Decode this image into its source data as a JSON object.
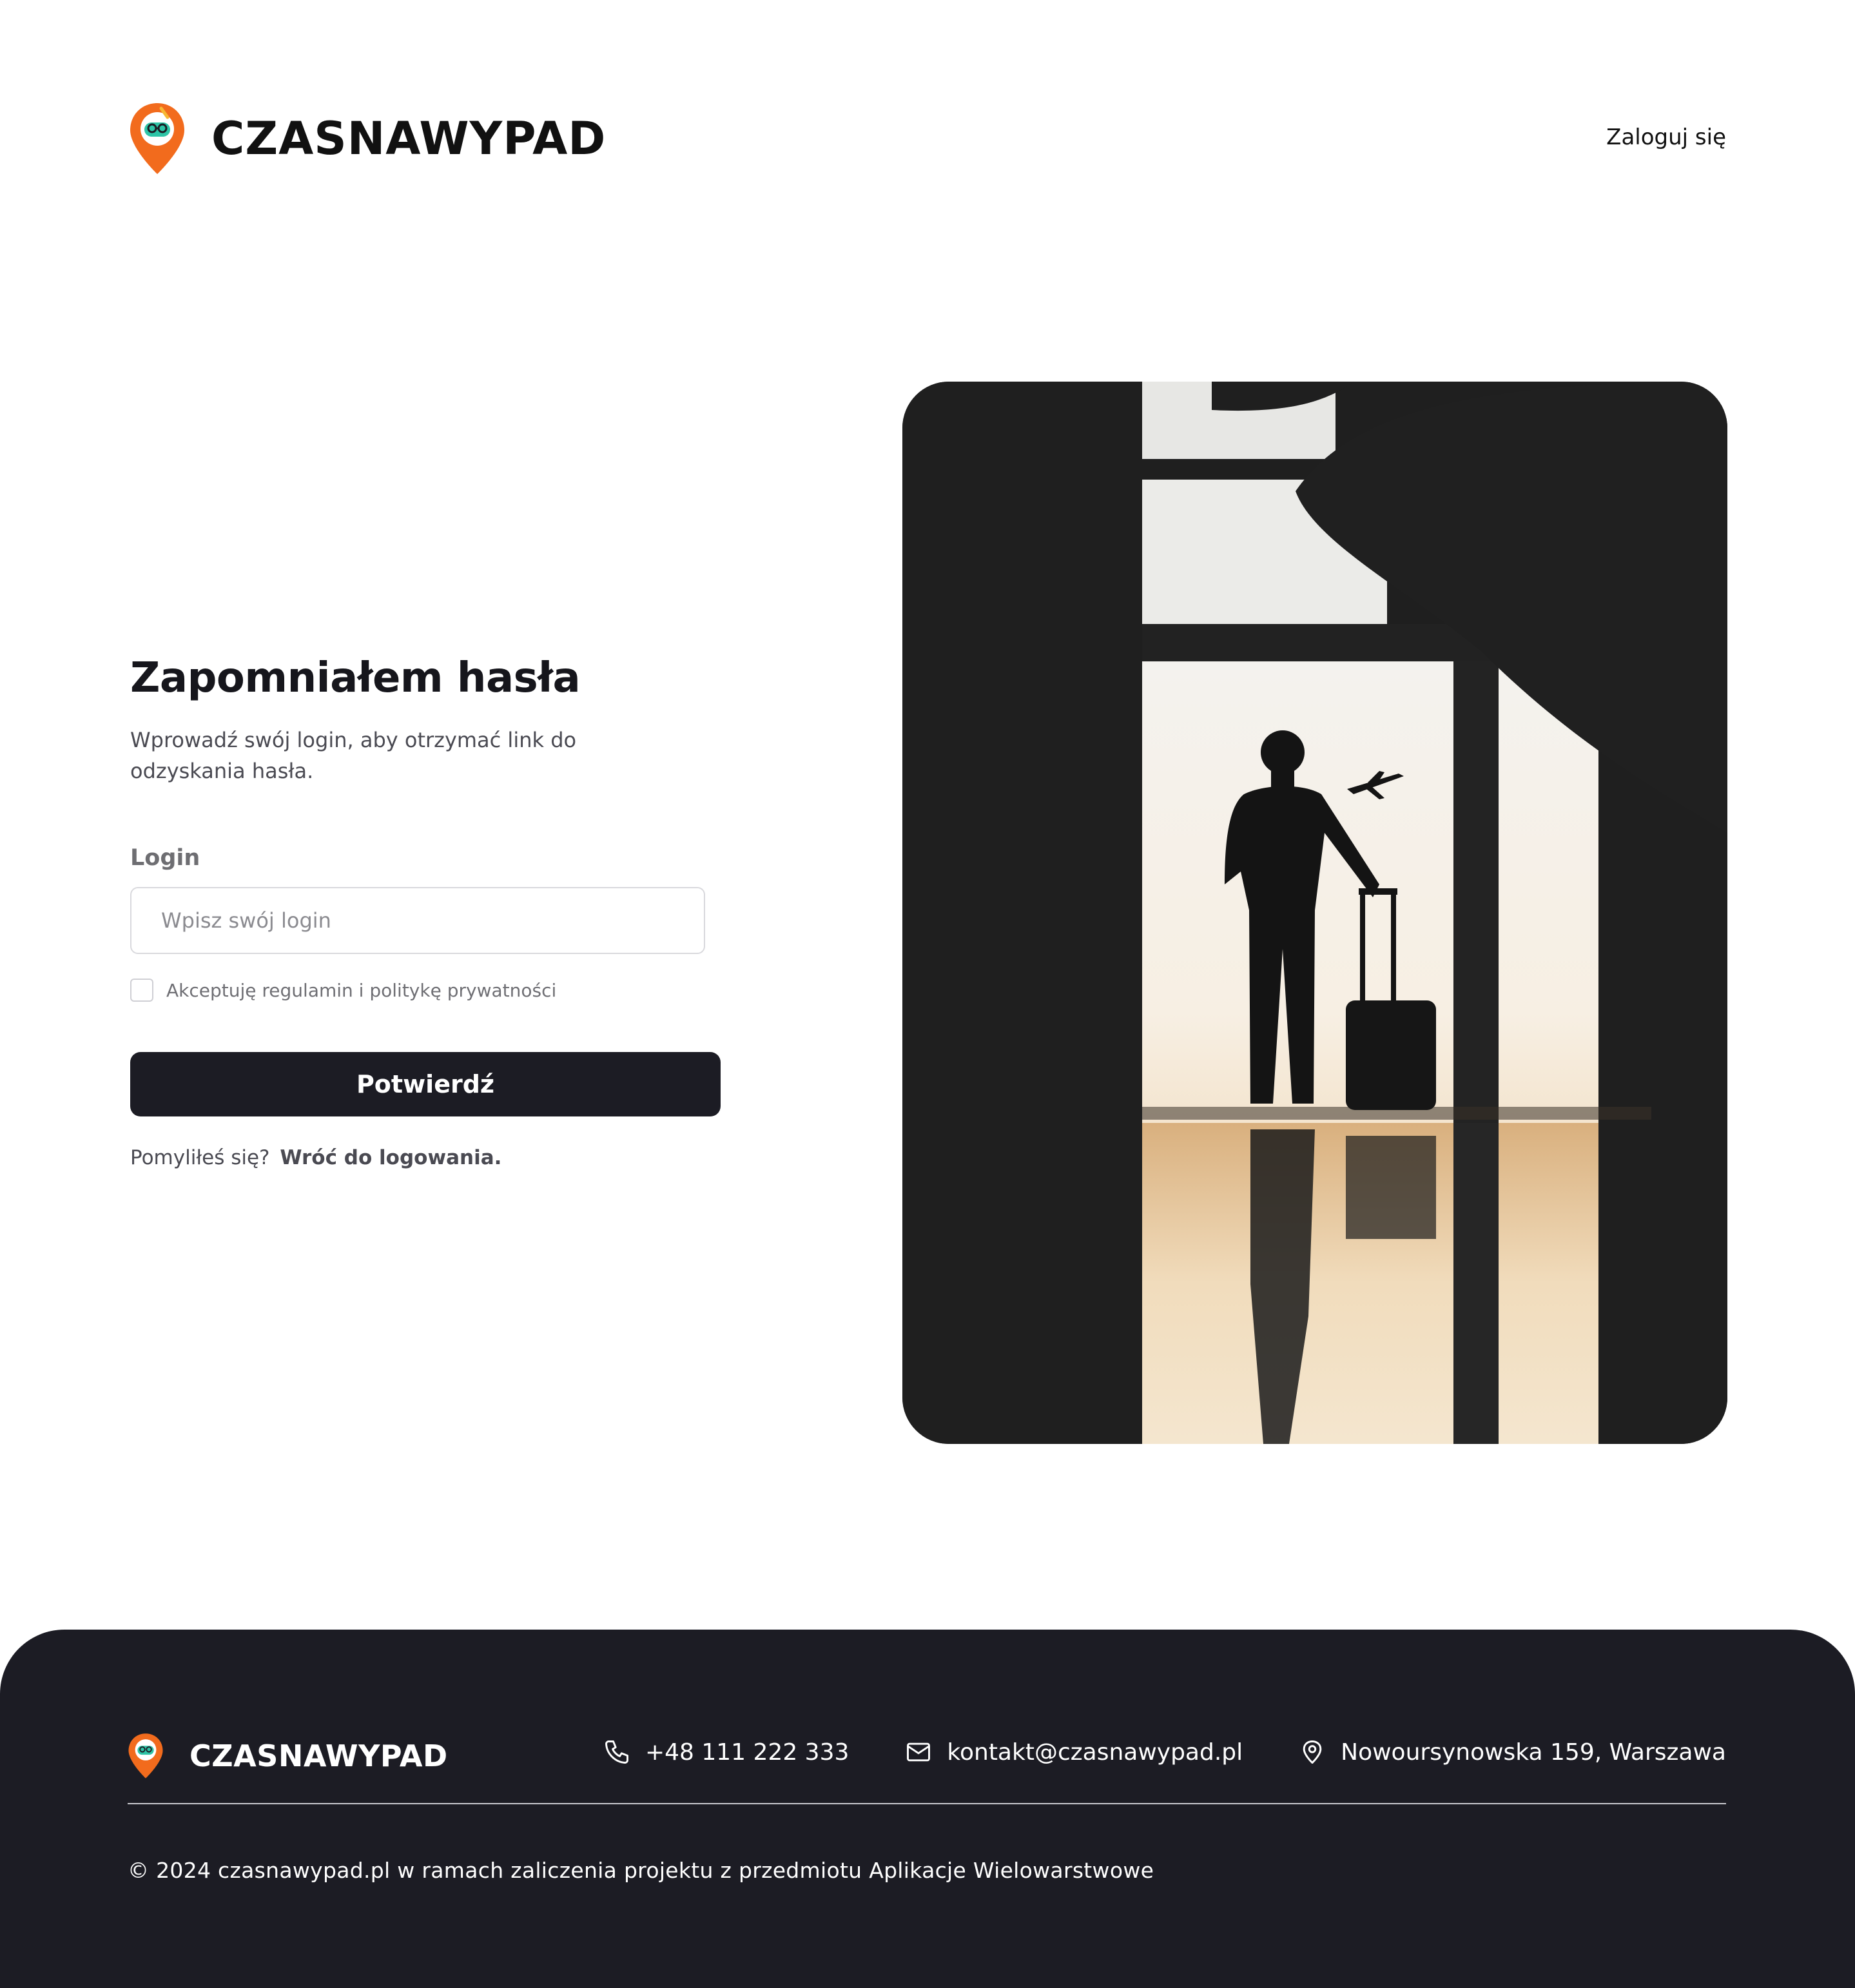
{
  "header": {
    "brand": "CZASNAWYPAD",
    "login_link": "Zaloguj się"
  },
  "form": {
    "title": "Zapomniałem hasła",
    "subtitle": "Wprowadź swój login, aby otrzymać link do odzyskania hasła.",
    "login_label": "Login",
    "login_placeholder": "Wpisz swój login",
    "login_value": "",
    "terms_label": "Akceptuję regulamin i politykę prywatności",
    "terms_checked": false,
    "submit_label": "Potwierdź",
    "back_prompt": "Pomyliłeś się?",
    "back_link": "Wróć do logowania."
  },
  "hero": {
    "icon": "traveler-silhouette-photo"
  },
  "footer": {
    "brand": "CZASNAWYPAD",
    "phone": "+48 111 222 333",
    "email": "kontakt@czasnawypad.pl",
    "address": "Nowoursynowska 159, Warszawa",
    "copyright": "© 2024 czasnawypad.pl w ramach zaliczenia projektu z przedmiotu Aplikacje Wielowarstwowe"
  },
  "colors": {
    "brand_orange": "#f26b1d",
    "brand_teal": "#2ec4a6",
    "dark": "#1c1c24",
    "muted_text": "#6e6e72"
  }
}
